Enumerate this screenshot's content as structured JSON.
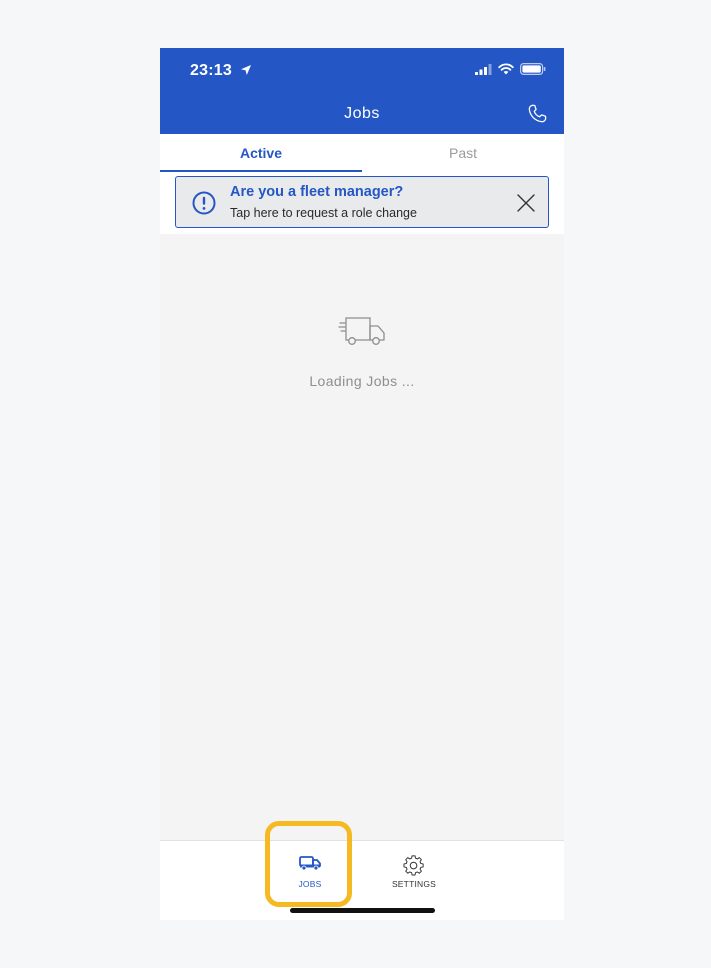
{
  "status_bar": {
    "time": "23:13"
  },
  "header": {
    "title": "Jobs"
  },
  "tabs": [
    {
      "label": "Active",
      "active": true
    },
    {
      "label": "Past",
      "active": false
    }
  ],
  "banner": {
    "title": "Are you a fleet manager?",
    "subtitle": "Tap here to request a role change"
  },
  "content": {
    "loading_text": "Loading Jobs ..."
  },
  "bottom_nav": {
    "items": [
      {
        "label": "JOBS",
        "icon": "truck-icon",
        "active": true
      },
      {
        "label": "SETTINGS",
        "icon": "gear-icon",
        "active": false
      }
    ]
  },
  "colors": {
    "brand": "#2457c5",
    "highlight": "#f5b921"
  }
}
